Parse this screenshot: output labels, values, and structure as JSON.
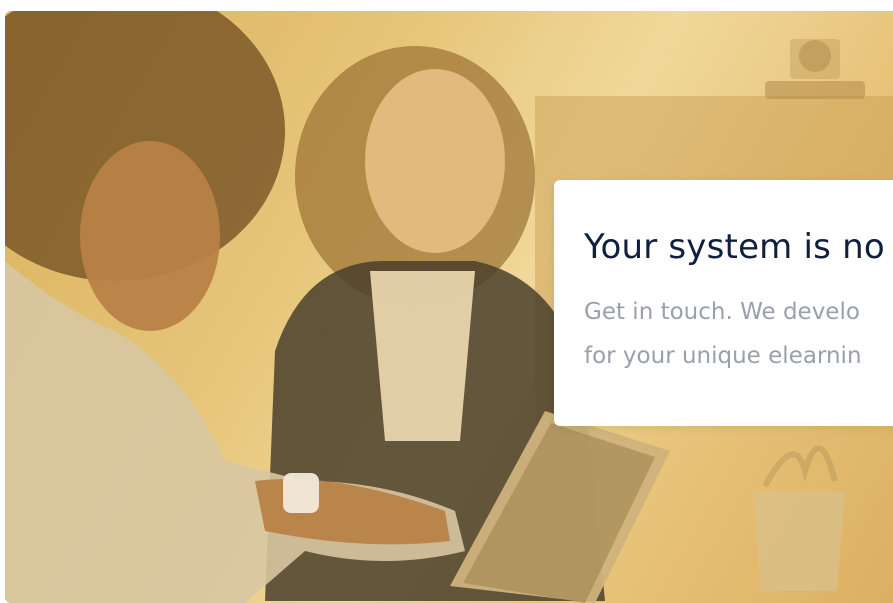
{
  "hero": {
    "image": "two-women-looking-at-tablet"
  },
  "card": {
    "heading": "Your system is no",
    "body_line1": "Get in touch. We develo",
    "body_line2": "for your unique elearnin"
  },
  "colors": {
    "overlay": "#e7c67a",
    "heading": "#0f1f3d",
    "body": "#9aa0aa",
    "card_bg": "#ffffff"
  }
}
